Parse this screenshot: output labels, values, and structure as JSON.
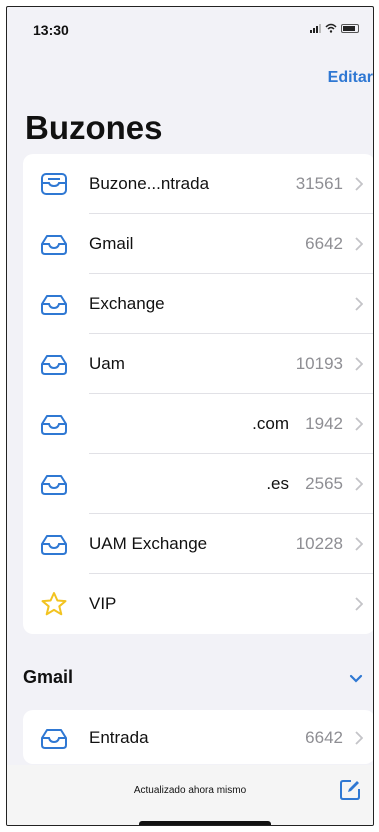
{
  "status": {
    "time": "13:30"
  },
  "header": {
    "edit_label": "Editar",
    "title": "Buzones"
  },
  "mailboxes": [
    {
      "label": "Buzone...ntrada",
      "count": "31561",
      "icon": "all-inboxes-icon"
    },
    {
      "label": "Gmail",
      "count": "6642",
      "icon": "inbox-icon"
    },
    {
      "label": "Exchange",
      "count": "",
      "icon": "inbox-icon"
    },
    {
      "label": "Uam",
      "count": "10193",
      "icon": "inbox-icon"
    },
    {
      "label": ".com",
      "count": "1942",
      "icon": "inbox-icon"
    },
    {
      "label": ".es",
      "count": "2565",
      "icon": "inbox-icon"
    },
    {
      "label": "UAM Exchange",
      "count": "10228",
      "icon": "inbox-icon"
    },
    {
      "label": "VIP",
      "count": "",
      "icon": "star-icon"
    }
  ],
  "section": {
    "title": "Gmail",
    "items": [
      {
        "label": "Entrada",
        "count": "6642",
        "icon": "inbox-icon"
      }
    ]
  },
  "footer": {
    "updated_text": "Actualizado ahora mismo"
  },
  "colors": {
    "accent": "#2f78d3",
    "star": "#f2c320",
    "count": "#8e8e93",
    "background": "#f2f2f7"
  }
}
